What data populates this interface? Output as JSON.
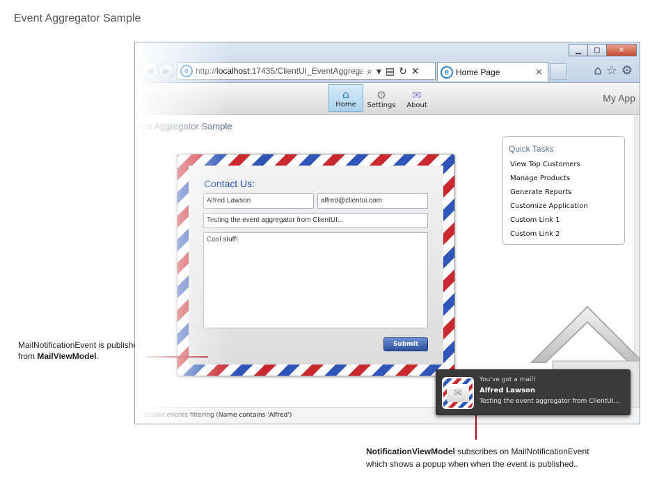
{
  "page_heading": "Event Aggregator Sample",
  "browser": {
    "url_prefix": "http://",
    "url_host": "localhost",
    "url_rest": ":17435/ClientUI_EventAggrega",
    "tab_title": "Home Page"
  },
  "app": {
    "name": "My App",
    "title": "vent Aggregator Sample",
    "nav": [
      {
        "label": "Home",
        "icon": "home-icon"
      },
      {
        "label": "Settings",
        "icon": "gear-icon"
      },
      {
        "label": "About",
        "icon": "about-icon"
      }
    ],
    "quick_tasks": {
      "title": "Quick Tasks",
      "links": [
        "View Top Customers",
        "Manage Products",
        "Generate Reports",
        "Customize Application",
        "Custom Link 1",
        "Custom Link 2"
      ]
    },
    "status_text": "Enable events filtering (Name contains 'Alfred')"
  },
  "contact_form": {
    "title": "Contact Us:",
    "name": "Alfred Lawson",
    "email": "alfred@clientui.com",
    "subject": "Testing the event aggregator from ClientUI...",
    "body": "Cool stuff!",
    "submit_label": "Submit"
  },
  "notification": {
    "kicker": "You've got a mail!",
    "sender": "Alfred Lawson",
    "message": "Testing the event aggregator from ClientUI..."
  },
  "callouts": {
    "left_line1": "MailNotificationEvent is published",
    "left_from": "from ",
    "left_bold": "MailViewModel",
    "left_end": ".",
    "bottom_bold": "NotificationViewModel",
    "bottom_line1_rest": " subscribes on MailNotificationEvent",
    "bottom_line2": "which shows a popup when when the event is published.."
  },
  "colors": {
    "accent_red": "#a1141a",
    "envelope_red": "#c9282f",
    "envelope_blue": "#2f55b8",
    "link_blue": "#1e4aa8"
  }
}
